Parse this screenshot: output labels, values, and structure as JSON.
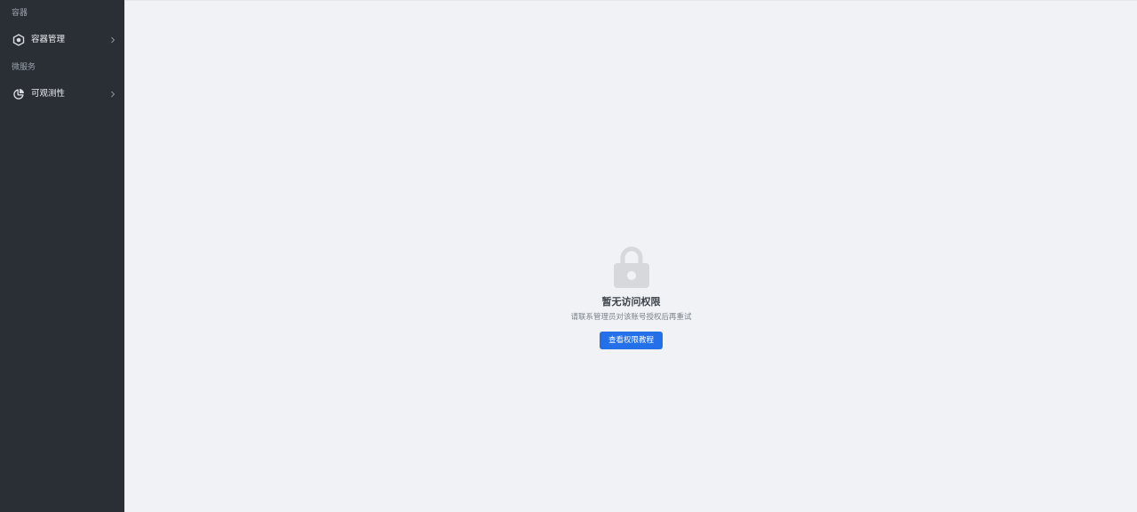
{
  "sidebar": {
    "groups": [
      {
        "title": "容器",
        "items": [
          {
            "label": "容器管理",
            "icon": "container-icon"
          }
        ]
      },
      {
        "title": "微服务",
        "items": [
          {
            "label": "可观测性",
            "icon": "observability-icon"
          }
        ]
      }
    ]
  },
  "main": {
    "empty_state": {
      "icon": "lock-icon",
      "title": "暂无访问权限",
      "description": "请联系管理员对该账号授权后再重试",
      "button_label": "查看权限教程"
    }
  },
  "colors": {
    "sidebar_bg": "#2a2f36",
    "main_bg": "#f0f2f5",
    "primary": "#2470e8",
    "lock_icon": "#d6d8dc"
  }
}
